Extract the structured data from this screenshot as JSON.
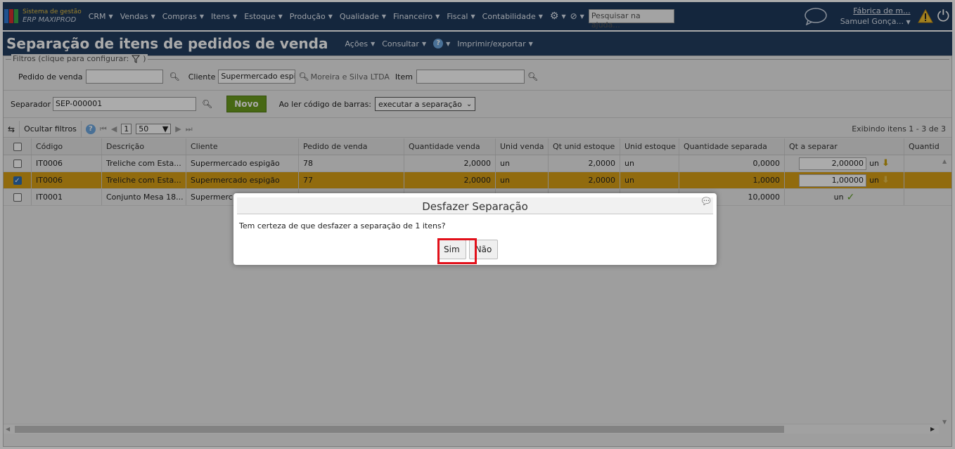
{
  "nav": {
    "logo_line1": "Sistema de gestão",
    "logo_line2": "ERP MAXIPROD",
    "menus": [
      "CRM",
      "Vendas",
      "Compras",
      "Itens",
      "Estoque",
      "Produção",
      "Qualidade",
      "Financeiro",
      "Fiscal",
      "Contabilidade"
    ],
    "search_value": "Pesquisar na ajuda...",
    "company": "Fábrica de m...",
    "user": "Samuel Gonça..."
  },
  "title": {
    "text": "Separação de itens de pedidos de venda",
    "menus": [
      "Ações",
      "Consultar",
      "Imprimir/exportar"
    ]
  },
  "filters": {
    "legend": "Filtros (clique para configurar:",
    "legend_end": ")",
    "pedido_label": "Pedido de venda",
    "pedido_value": "",
    "cliente_label": "Cliente",
    "cliente_value": "Supermercado espi",
    "cliente_name": "Moreira e Silva LTDA",
    "item_label": "Item",
    "item_value": ""
  },
  "separator": {
    "label": "Separador",
    "value": "SEP-000001",
    "novo": "Novo",
    "barcode_label": "Ao ler código de barras:",
    "barcode_option": "executar a separação"
  },
  "toolbar": {
    "hide_filters": "Ocultar filtros",
    "page": "1",
    "page_size": "50",
    "showing": "Exibindo itens 1 - 3 de 3"
  },
  "grid": {
    "headers": [
      "Código",
      "Descrição",
      "Cliente",
      "Pedido de venda",
      "Quantidade venda",
      "Unid venda",
      "Qt unid estoque",
      "Unid estoque",
      "Quantidade separada",
      "Qt a separar",
      "Quantid"
    ],
    "rows": [
      {
        "codigo": "IT0006",
        "descricao": "Treliche com Esta...",
        "cliente": "Supermercado espigão",
        "pedido": "78",
        "qtd_venda": "2,0000",
        "unid_venda": "un",
        "qt_unid_estoque": "2,0000",
        "unid_estoque": "un",
        "qtd_separada": "0,0000",
        "qt_separar": "2,00000",
        "qt_unit": "un"
      },
      {
        "codigo": "IT0006",
        "descricao": "Treliche com Esta...",
        "cliente": "Supermercado espigão",
        "pedido": "77",
        "qtd_venda": "2,0000",
        "unid_venda": "un",
        "qt_unid_estoque": "2,0000",
        "unid_estoque": "un",
        "qtd_separada": "1,0000",
        "qt_separar": "1,00000",
        "qt_unit": "un"
      },
      {
        "codigo": "IT0001",
        "descricao": "Conjunto Mesa 18...",
        "cliente": "Supermerc",
        "pedido": "",
        "qtd_venda": "",
        "unid_venda": "",
        "qt_unid_estoque": "",
        "unid_estoque": "",
        "qtd_separada": "10,0000",
        "qt_separar": "",
        "qt_unit": "un"
      }
    ]
  },
  "modal": {
    "title": "Desfazer Separação",
    "message": "Tem certeza de que desfazer a separação de 1 itens?",
    "yes": "Sim",
    "no": "Não"
  },
  "colors": {
    "nav_bg": "#1f3a5c",
    "selected_row": "#d9a015",
    "novo_button": "#6a9c1e",
    "highlight": "#e2101a"
  }
}
